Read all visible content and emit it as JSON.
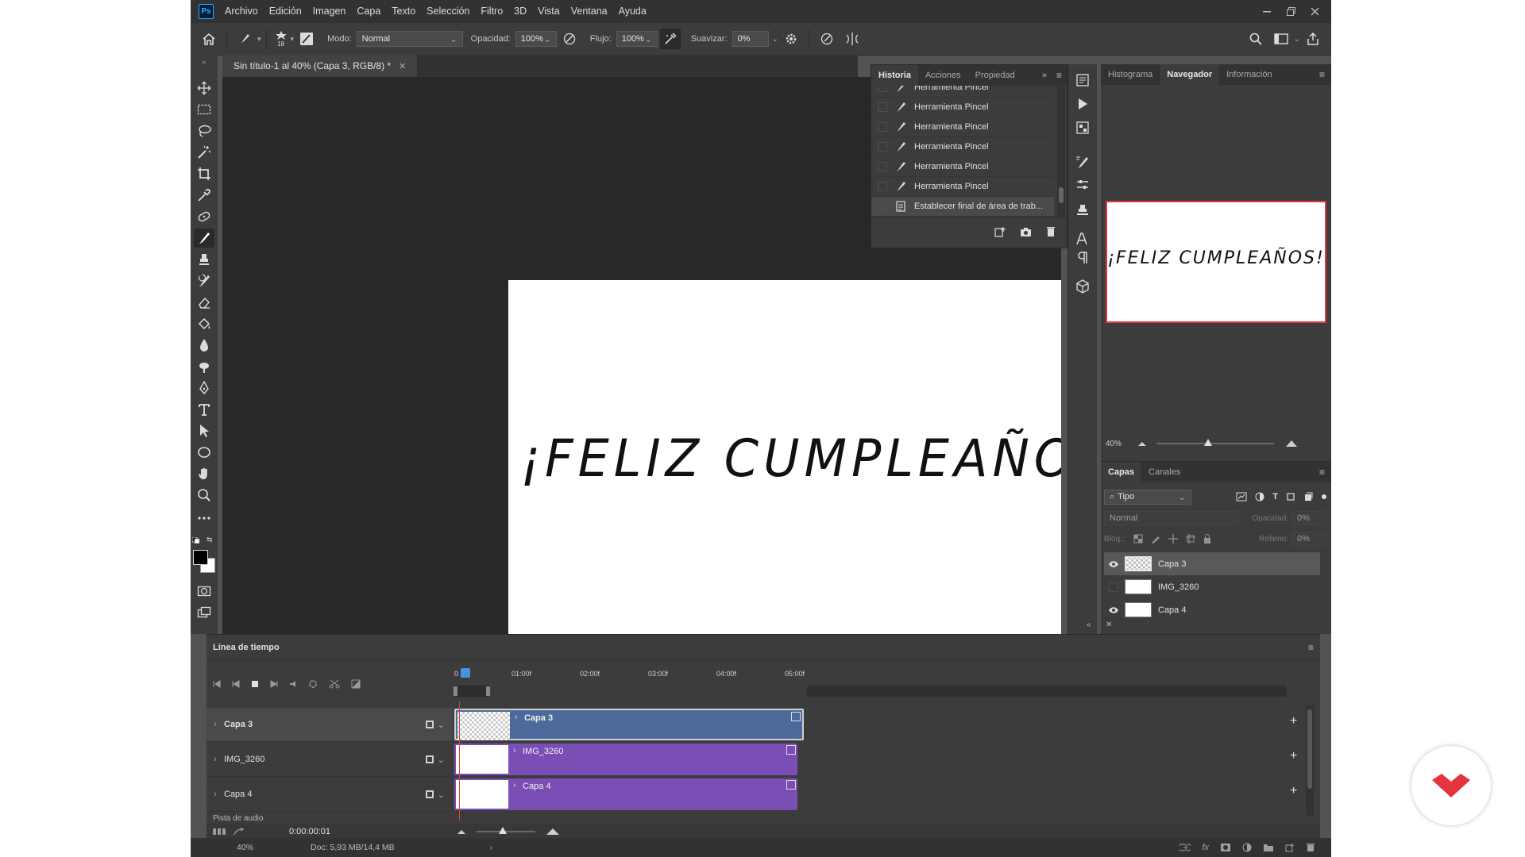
{
  "app": {
    "logo_text": "Ps",
    "menu": [
      "Archivo",
      "Edición",
      "Imagen",
      "Capa",
      "Texto",
      "Selección",
      "Filtro",
      "3D",
      "Vista",
      "Ventana",
      "Ayuda"
    ],
    "window_controls": [
      "minimize",
      "restore",
      "close"
    ]
  },
  "options": {
    "brush_size": "18",
    "mode_label": "Modo:",
    "mode_value": "Normal",
    "opacity_label": "Opacidad:",
    "opacity_value": "100%",
    "flow_label": "Flujo:",
    "flow_value": "100%",
    "smoothing_label": "Suavizar:",
    "smoothing_value": "0%"
  },
  "document": {
    "tab_title": "Sin título-1 al 40% (Capa 3, RGB/8) *",
    "canvas_text": "¡FELIZ CUMPLEAÑOS!"
  },
  "history": {
    "tabs": [
      "Historia",
      "Acciones",
      "Propiedad"
    ],
    "active_tab": "Historia",
    "items": [
      "Herramienta Pincel",
      "Herramienta Pincel",
      "Herramienta Pincel",
      "Herramienta Pincel",
      "Herramienta Pincel",
      "Herramienta Pincel",
      "Establecer final de área de trab..."
    ]
  },
  "navigator": {
    "tabs": [
      "Histograma",
      "Navegador",
      "Información"
    ],
    "active_tab": "Navegador",
    "zoom": "40%"
  },
  "layers": {
    "tabs": [
      "Capas",
      "Canales"
    ],
    "active_tab": "Capas",
    "filter_label": "Tipo",
    "blend_mode": "Normal",
    "opacity_label": "Opacidad:",
    "opacity_value": "0%",
    "lock_label": "Bloq.:",
    "fill_label": "Relleno:",
    "fill_value": "0%",
    "items": [
      {
        "name": "Capa 3",
        "visible": true,
        "selected": true
      },
      {
        "name": "IMG_3260",
        "visible": false,
        "selected": false
      },
      {
        "name": "Capa 4",
        "visible": true,
        "selected": false
      }
    ]
  },
  "timeline": {
    "title": "Línea de tiempo",
    "ruler": [
      "0",
      "01:00f",
      "02:00f",
      "03:00f",
      "04:00f",
      "05:00f"
    ],
    "tracks": [
      {
        "name": "Capa 3",
        "clip": "Capa 3",
        "color": "#4b6a9b"
      },
      {
        "name": "IMG_3260",
        "clip": "IMG_3260",
        "color": "#7a4fb5"
      },
      {
        "name": "Capa 4",
        "clip": "Capa 4",
        "color": "#7a4fb5"
      }
    ],
    "audio_track": "Pista de audio",
    "timecode": "0:00:00:01"
  },
  "status": {
    "zoom": "40%",
    "doc_info": "Doc: 5,93 MB/14,4 MB"
  },
  "colors": {
    "accent": "#e3343f",
    "ps_blue": "#31a8ff"
  }
}
